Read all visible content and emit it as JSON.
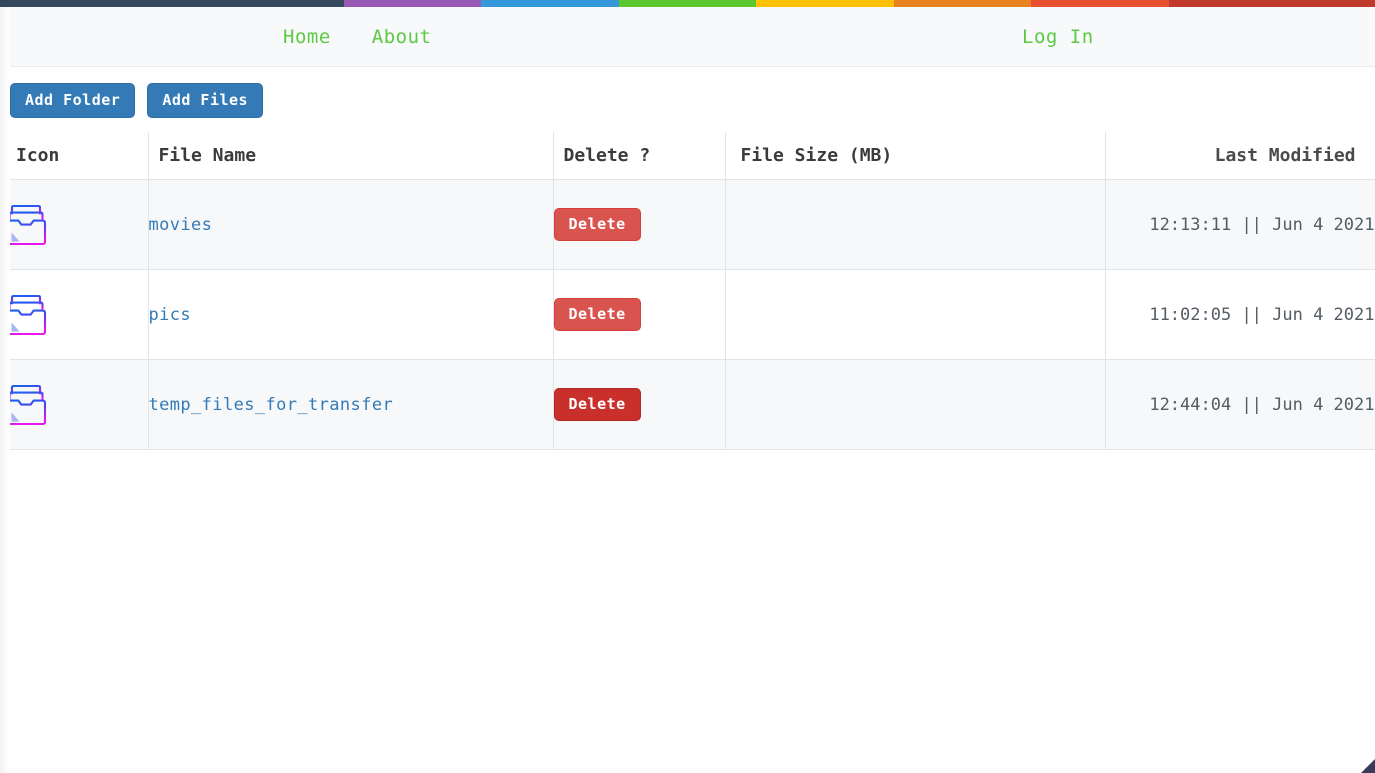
{
  "stripe": {
    "colors": [
      "#34495e",
      "#9b59b6",
      "#3498db",
      "#5cc62f",
      "#ffc107",
      "#e8811f",
      "#e8502f",
      "#c0392b"
    ]
  },
  "navbar": {
    "links": [
      {
        "label": "Home",
        "name": "nav-link-home"
      },
      {
        "label": "About",
        "name": "nav-link-about"
      }
    ],
    "login_label": "Log In",
    "link_color": "#5cc943"
  },
  "toolbar": {
    "add_folder_label": "Add Folder",
    "add_files_label": "Add Files",
    "button_color": "#337ab7"
  },
  "table": {
    "headers": {
      "icon": "Icon",
      "file_name": "File Name",
      "delete": "Delete ?",
      "file_size": "File Size (MB)",
      "last_modified": "Last Modified"
    },
    "delete_label": "Delete",
    "delete_color": "#d9534f",
    "delete_hover_color": "#c9302c",
    "rows": [
      {
        "icon": "folder-archive-icon",
        "name": "movies",
        "delete": "Delete",
        "delete_hovered": false,
        "size": "",
        "last_modified": "12:13:11 || Jun 4 2021"
      },
      {
        "icon": "folder-archive-icon",
        "name": "pics",
        "delete": "Delete",
        "delete_hovered": false,
        "size": "",
        "last_modified": "11:02:05 || Jun 4 2021"
      },
      {
        "icon": "folder-archive-icon",
        "name": "temp_files_for_transfer",
        "delete": "Delete",
        "delete_hovered": true,
        "size": "",
        "last_modified": "12:44:04 || Jun 4 2021"
      }
    ]
  }
}
